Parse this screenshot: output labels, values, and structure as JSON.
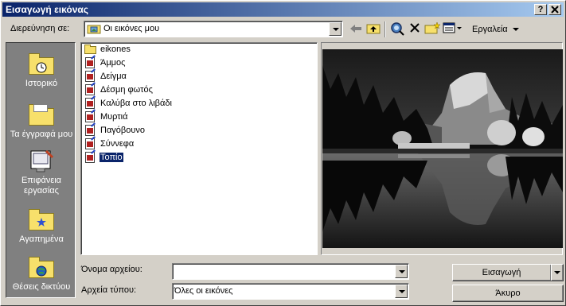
{
  "dialog": {
    "title": "Εισαγωγή εικόνας",
    "help_button": "?",
    "close_button": "X"
  },
  "lookin": {
    "label": "Διερεύνηση σε:",
    "value": "Οι εικόνες μου"
  },
  "toolbar": {
    "back_icon": "back-arrow-icon",
    "up_icon": "up-folder-icon",
    "search_icon": "search-web-icon",
    "delete_icon": "delete-icon",
    "new_folder_icon": "new-folder-icon",
    "views_icon": "views-icon",
    "tools_label": "Εργαλεία"
  },
  "places": [
    {
      "label": "Ιστορικό",
      "icon": "history-folder-icon"
    },
    {
      "label": "Τα έγγραφά μου",
      "icon": "my-documents-icon"
    },
    {
      "label": "Επιφάνεια εργασίας",
      "icon": "desktop-icon"
    },
    {
      "label": "Αγαπημένα",
      "icon": "favorites-icon"
    },
    {
      "label": "Θέσεις δικτύου",
      "icon": "network-places-icon"
    }
  ],
  "files": [
    {
      "name": "eikones",
      "type": "folder"
    },
    {
      "name": "Άμμος",
      "type": "image"
    },
    {
      "name": "Δείγμα",
      "type": "image"
    },
    {
      "name": "Δέσμη φωτός",
      "type": "image"
    },
    {
      "name": "Καλύβα στο λιβάδι",
      "type": "image"
    },
    {
      "name": "Μυρτιά",
      "type": "image"
    },
    {
      "name": "Παγόβουνο",
      "type": "image"
    },
    {
      "name": "Σύννεφα",
      "type": "image"
    },
    {
      "name": "Τοπίο",
      "type": "image",
      "selected": true
    }
  ],
  "filename": {
    "label": "Όνομα αρχείου:",
    "value": ""
  },
  "filetype": {
    "label": "Αρχεία τύπου:",
    "value": "Όλες οι εικόνες"
  },
  "buttons": {
    "insert": "Εισαγωγή",
    "cancel": "Άκυρο"
  },
  "colors": {
    "title_start": "#0a246a",
    "title_end": "#a6caf0",
    "face": "#d4d0c8",
    "selection": "#0a246a"
  }
}
